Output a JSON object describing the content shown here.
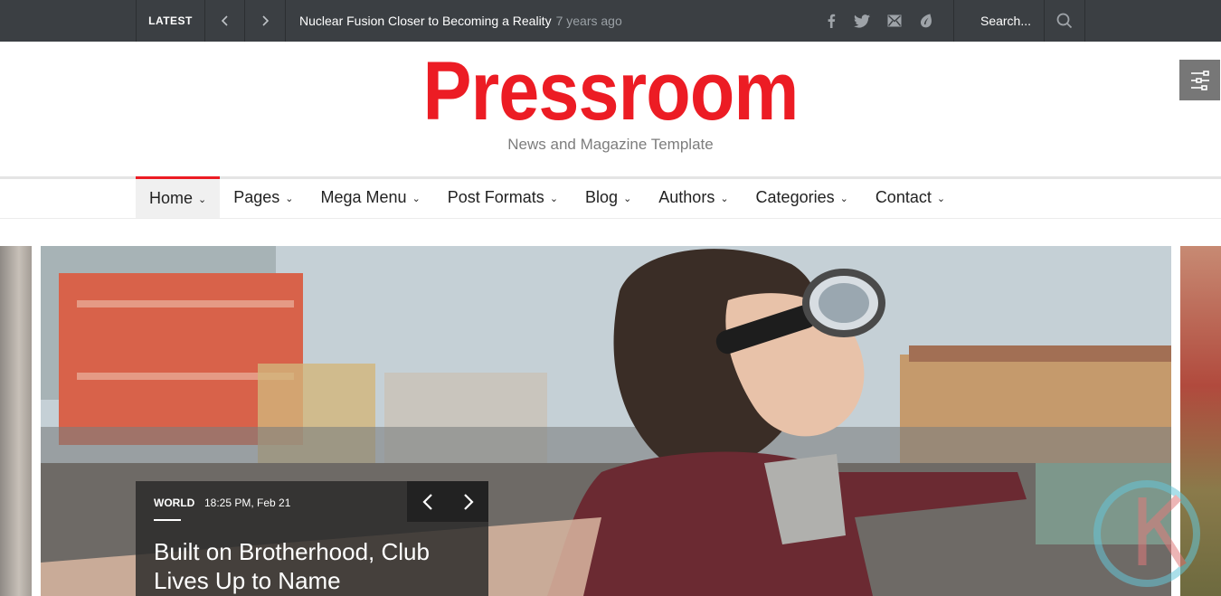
{
  "topbar": {
    "latest_label": "LATEST",
    "prev_icon": "chevron-left-icon",
    "next_icon": "chevron-right-icon",
    "headline": "Nuclear Fusion Closer to Becoming a Reality",
    "headline_ago": "7 years ago",
    "social": [
      "facebook-icon",
      "twitter-icon",
      "mail-icon",
      "envato-icon"
    ],
    "search_placeholder": "Search..."
  },
  "header": {
    "logo": "Pressroom",
    "tagline": "News and Magazine Template",
    "accent": "#ec1c24"
  },
  "menu": {
    "items": [
      {
        "label": "Home",
        "active": true
      },
      {
        "label": "Pages"
      },
      {
        "label": "Mega Menu"
      },
      {
        "label": "Post Formats"
      },
      {
        "label": "Blog"
      },
      {
        "label": "Authors"
      },
      {
        "label": "Categories"
      },
      {
        "label": "Contact"
      }
    ]
  },
  "slide": {
    "category": "WORLD",
    "date": "18:25 PM, Feb 21",
    "title": "Built on Brotherhood, Club Lives Up to Name"
  }
}
